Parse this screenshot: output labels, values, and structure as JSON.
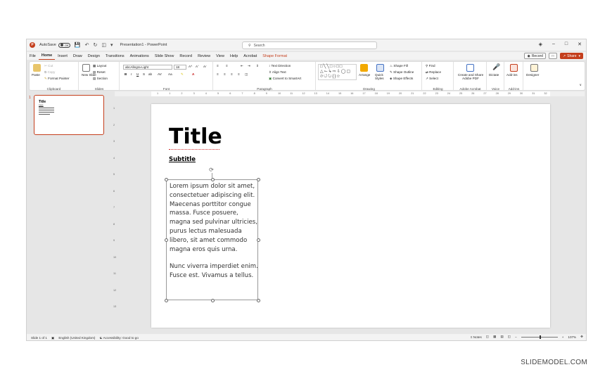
{
  "titlebar": {
    "autosave_label": "AutoSave",
    "autosave_state": "Off",
    "document_title": "Presentation1 - PowerPoint",
    "search_placeholder": "Search"
  },
  "menu": {
    "tabs": [
      "File",
      "Home",
      "Insert",
      "Draw",
      "Design",
      "Transitions",
      "Animations",
      "Slide Show",
      "Record",
      "Review",
      "View",
      "Help",
      "Acrobat",
      "Shape Format"
    ],
    "active_tab": "Home",
    "record_label": "Record",
    "share_label": "Share"
  },
  "ribbon": {
    "clipboard": {
      "paste": "Paste",
      "cut": "Cut",
      "copy": "Copy",
      "format_painter": "Format Painter",
      "label": "Clipboard"
    },
    "slides": {
      "new_slide": "New Slide",
      "layout": "Layout",
      "reset": "Reset",
      "section": "Section",
      "label": "Slides"
    },
    "font": {
      "font_name": "abcAllegra-Light",
      "font_size": "18",
      "bold": "B",
      "italic": "I",
      "underline": "U",
      "strike": "S",
      "label": "Font"
    },
    "paragraph": {
      "text_direction": "Text Direction",
      "align_text": "Align Text",
      "convert_smartart": "Convert to SmartArt",
      "label": "Paragraph"
    },
    "drawing": {
      "arrange": "Arrange",
      "quick_styles": "Quick Styles",
      "shape_fill": "Shape Fill",
      "shape_outline": "Shape Outline",
      "shape_effects": "Shape Effects",
      "label": "Drawing"
    },
    "editing": {
      "find": "Find",
      "replace": "Replace",
      "select": "Select",
      "label": "Editing"
    },
    "acrobat": {
      "create_share": "Create and Share Adobe PDF",
      "label": "Adobe Acrobat"
    },
    "voice": {
      "dictate": "Dictate",
      "label": "Voice"
    },
    "addins": {
      "addins": "Add-ins",
      "label": "Add-ins"
    },
    "designer": {
      "label": "Designer"
    }
  },
  "ruler_h": [
    "1",
    "1",
    "2",
    "3",
    "4",
    "5",
    "6",
    "7",
    "8",
    "9",
    "10",
    "11",
    "12",
    "13",
    "14",
    "15",
    "16",
    "17",
    "18",
    "19",
    "20",
    "21",
    "22",
    "23",
    "24",
    "25",
    "26",
    "27",
    "28",
    "29",
    "30",
    "31",
    "32"
  ],
  "ruler_v": [
    "1",
    "2",
    "3",
    "4",
    "5",
    "6",
    "7",
    "8",
    "9",
    "10",
    "11",
    "12",
    "13"
  ],
  "thumbnail": {
    "number": "1",
    "title": "Title",
    "subtitle": "Subtitle"
  },
  "slide": {
    "title": "Title",
    "subtitle": "Subtitle",
    "paragraph1": "Lorem ipsum dolor sit amet, consectetuer adipiscing elit. Maecenas porttitor congue massa. Fusce posuere, magna sed pulvinar ultricies, purus lectus malesuada libero, sit amet commodo magna eros quis urna.",
    "paragraph2": "Nunc viverra imperdiet enim. Fusce est. Vivamus a tellus."
  },
  "status": {
    "slide_count": "Slide 1 of 1",
    "language": "English (United Kingdom)",
    "accessibility": "Accessibility: Good to go",
    "notes": "Notes",
    "zoom": "107%"
  },
  "watermark": "SLIDEMODEL.COM",
  "colors": {
    "accent": "#c43e1c",
    "window_bg": "#e6e6e6",
    "ribbon_bg": "#ffffff"
  }
}
